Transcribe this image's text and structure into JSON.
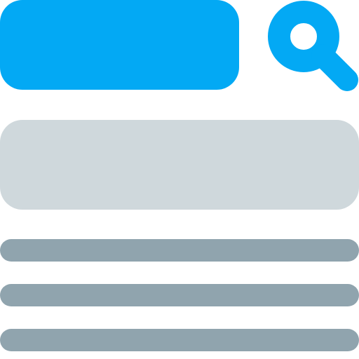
{
  "icons": {
    "search": "search-icon"
  },
  "colors": {
    "accent": "#03a9f4",
    "block": "#cfd8dc",
    "line": "#90a4ae",
    "background": "#ffffff"
  }
}
